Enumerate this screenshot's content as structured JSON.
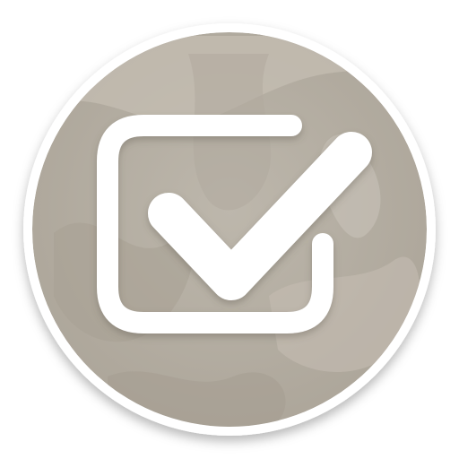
{
  "icon": {
    "name": "checkbox-checked-icon",
    "state": "checked"
  },
  "colors": {
    "badge_fill": "#b8b1a6",
    "badge_ring": "#ffffff",
    "marble_light": "#c9c3b8",
    "marble_dark": "#aaa296",
    "glyph": "#ffffff"
  }
}
